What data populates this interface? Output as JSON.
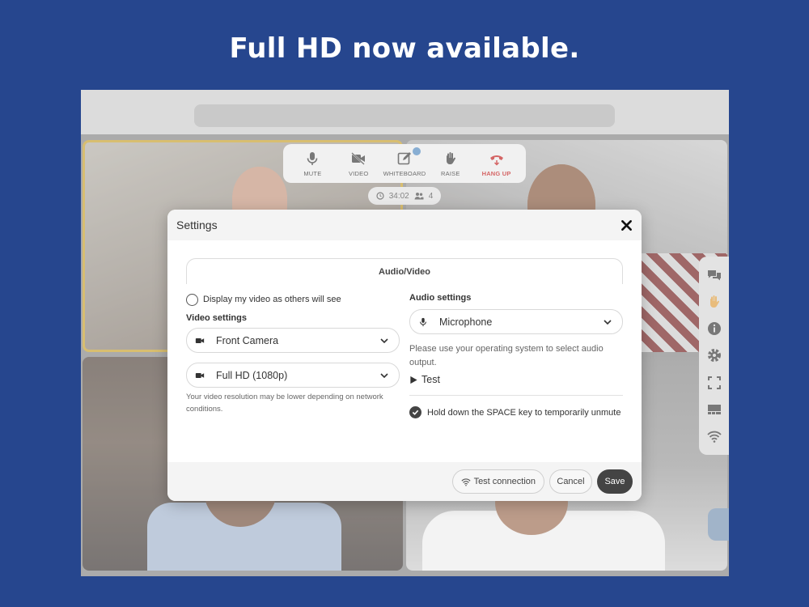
{
  "headline": "Full HD now available.",
  "controls": {
    "mute": "MUTE",
    "video": "VIDEO",
    "whiteboard": "WHITEBOARD",
    "raise": "RAISE",
    "hangup": "HANG UP"
  },
  "meeting": {
    "timer": "34:02",
    "participants": "4"
  },
  "side_toolbar": [
    "chat-icon",
    "hand-icon",
    "info-icon",
    "gear-icon",
    "fullscreen-icon",
    "layout-icon",
    "wifi-icon"
  ],
  "settings": {
    "title": "Settings",
    "tab": "Audio/Video",
    "display_video_label": "Display my video as others will see",
    "video_settings_label": "Video settings",
    "camera_value": "Front Camera",
    "resolution_value": "Full HD (1080p)",
    "resolution_note": "Your video resolution may be lower depending on network conditions.",
    "audio_settings_label": "Audio settings",
    "microphone_value": "Microphone",
    "audio_output_note": "Please use your operating system to select audio output.",
    "test_label": "Test",
    "space_unmute_label": "Hold down the SPACE key to temporarily unmute",
    "buttons": {
      "test_connection": "Test connection",
      "cancel": "Cancel",
      "save": "Save"
    }
  },
  "colors": {
    "background": "#26468e",
    "hangup": "#c42a2a",
    "highlight": "#c9a63a",
    "primary_button": "#444444"
  }
}
